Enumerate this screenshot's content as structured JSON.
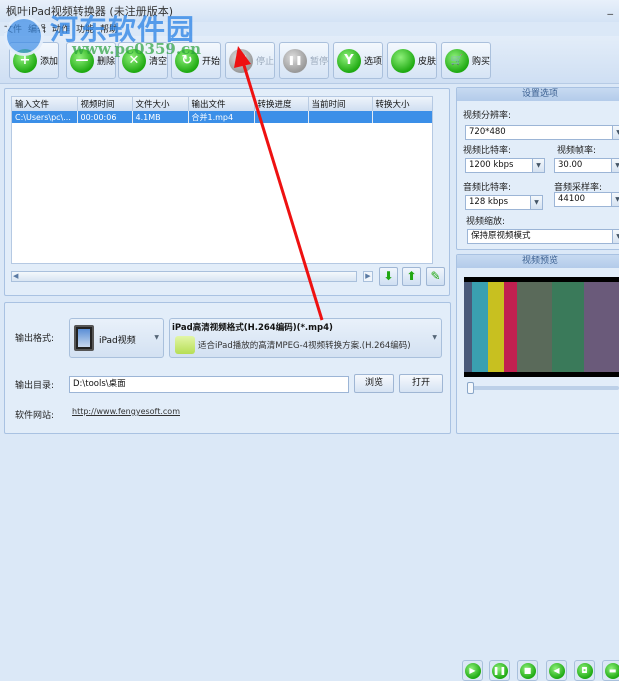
{
  "window": {
    "title": "枫叶iPad视频转换器  (未注册版本)",
    "minimize": "_"
  },
  "menu": [
    "文件",
    "编辑",
    "动作",
    "功能",
    "帮助"
  ],
  "watermark": {
    "name": "河东软件园",
    "url": "www.pc0359.cn"
  },
  "toolbar": [
    {
      "label": "添加",
      "icon": "+",
      "enabled": true
    },
    {
      "label": "删除",
      "icon": "—",
      "enabled": true
    },
    {
      "label": "清空",
      "icon": "✕",
      "enabled": true
    },
    {
      "label": "开始",
      "icon": "↻",
      "enabled": true
    },
    {
      "label": "停止",
      "icon": "■",
      "enabled": false
    },
    {
      "label": "暂停",
      "icon": "❚❚",
      "enabled": false
    },
    {
      "label": "选项",
      "icon": "Y",
      "enabled": true
    },
    {
      "label": "皮肤",
      "icon": "",
      "enabled": true
    },
    {
      "label": "购买",
      "icon": "🛒",
      "enabled": true
    }
  ],
  "file_list": {
    "columns": [
      "输入文件",
      "视频时间",
      "文件大小",
      "输出文件",
      "转换进度",
      "当前时间",
      "转换大小"
    ],
    "rows": [
      [
        "C:\\Users\\pc\\...",
        "00:00:06",
        "4.1MB",
        "合并1.mp4",
        "",
        "",
        ""
      ]
    ]
  },
  "list_buttons": {
    "down": "⬇",
    "up": "⬆",
    "edit": "✎"
  },
  "settings": {
    "title": "设置选项",
    "video_resolution_label": "视频分辨率:",
    "video_resolution": "720*480",
    "video_bitrate_label": "视频比特率:",
    "video_bitrate": "1200 kbps",
    "frame_rate_label": "视频帧率:",
    "frame_rate": "30.00",
    "audio_bitrate_label": "音频比特率:",
    "audio_bitrate": "128 kbps",
    "sample_rate_label": "音频采样率:",
    "sample_rate": "44100",
    "zoom_label": "视频缩放:",
    "zoom": "保持原视频模式"
  },
  "preview": {
    "title": "视频预览",
    "position": 0.0
  },
  "output": {
    "format_label": "输出格式:",
    "device": "iPad视频",
    "format_title": "iPad高清视频格式(H.264编码)(*.mp4)",
    "format_desc": "适合iPad播放的高清MPEG-4视频转换方案.(H.264编码)",
    "dir_label": "输出目录:",
    "dir": "D:\\tools\\桌面",
    "browse": "浏览",
    "open": "打开",
    "site_label": "软件网站:",
    "site": "http://www.fengyesoft.com"
  }
}
